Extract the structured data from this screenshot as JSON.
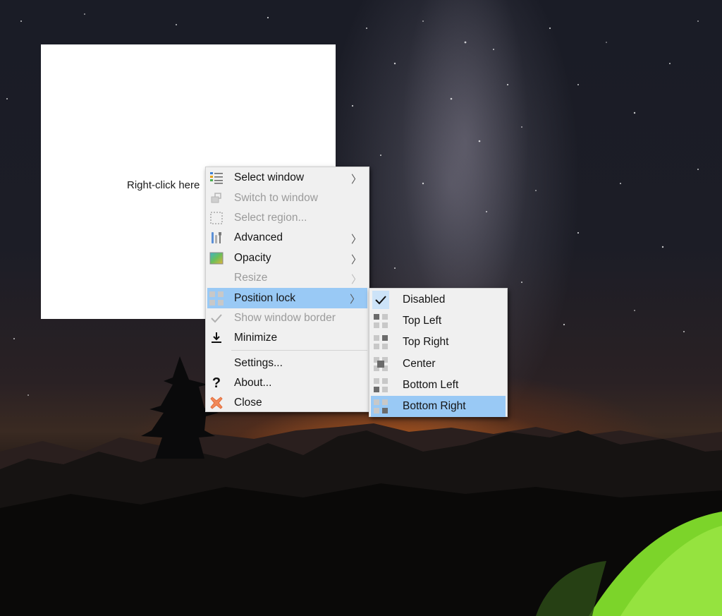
{
  "app_window": {
    "hint": "Right-click here"
  },
  "context_menu": {
    "items": [
      {
        "label": "Select window",
        "icon": "select-window-icon",
        "submenu": true,
        "enabled": true
      },
      {
        "label": "Switch to window",
        "icon": "switch-window-icon",
        "submenu": false,
        "enabled": false
      },
      {
        "label": "Select region...",
        "icon": "select-region-icon",
        "submenu": false,
        "enabled": false
      },
      {
        "label": "Advanced",
        "icon": "tools-icon",
        "submenu": true,
        "enabled": true
      },
      {
        "label": "Opacity",
        "icon": "opacity-icon",
        "submenu": true,
        "enabled": true
      },
      {
        "label": "Resize",
        "icon": "",
        "submenu": true,
        "enabled": false
      },
      {
        "label": "Position lock",
        "icon": "position-grid-icon",
        "submenu": true,
        "enabled": true,
        "highlighted": true
      },
      {
        "label": "Show window border",
        "icon": "checkmark-icon",
        "submenu": false,
        "enabled": false
      },
      {
        "label": "Minimize",
        "icon": "minimize-icon",
        "submenu": false,
        "enabled": true
      },
      {
        "label": "Settings...",
        "icon": "",
        "submenu": false,
        "enabled": true
      },
      {
        "label": "About...",
        "icon": "question-icon",
        "submenu": false,
        "enabled": true
      },
      {
        "label": "Close",
        "icon": "close-icon",
        "submenu": false,
        "enabled": true
      }
    ],
    "arrow_glyph": "〉"
  },
  "position_lock_submenu": {
    "items": [
      {
        "label": "Disabled",
        "icon": "checkmark-icon",
        "checked": true
      },
      {
        "label": "Top Left",
        "icon": "top-left-grid-icon"
      },
      {
        "label": "Top Right",
        "icon": "top-right-grid-icon"
      },
      {
        "label": "Center",
        "icon": "center-grid-icon"
      },
      {
        "label": "Bottom Left",
        "icon": "bottom-left-grid-icon"
      },
      {
        "label": "Bottom Right",
        "icon": "bottom-right-grid-icon",
        "highlighted": true
      }
    ]
  },
  "colors": {
    "menu_background": "#f0f0f0",
    "highlight": "#99c9f5",
    "disabled_text": "#9b9b9b",
    "sunset_orange": "#e66e1e",
    "tent_green": "#7cd42a"
  }
}
